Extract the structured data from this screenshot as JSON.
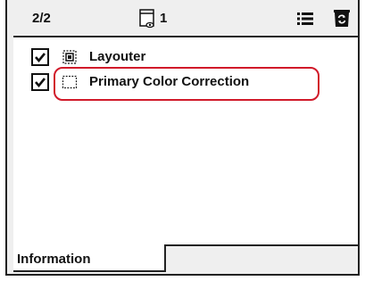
{
  "header": {
    "counter": "2/2",
    "clip_count": "1",
    "clip_icon": "clip-view-icon",
    "list_icon": "list-icon",
    "trash_icon": "trash-icon"
  },
  "effects": [
    {
      "label": "Layouter",
      "checked": true,
      "icon": "layouter-icon"
    },
    {
      "label": "Primary Color Correction",
      "checked": true,
      "icon": "color-correction-icon",
      "highlighted": true
    }
  ],
  "tabs": [
    {
      "label": "Information",
      "active": true
    }
  ],
  "colors": {
    "highlight": "#d11a2a",
    "panel": "#efefef"
  }
}
